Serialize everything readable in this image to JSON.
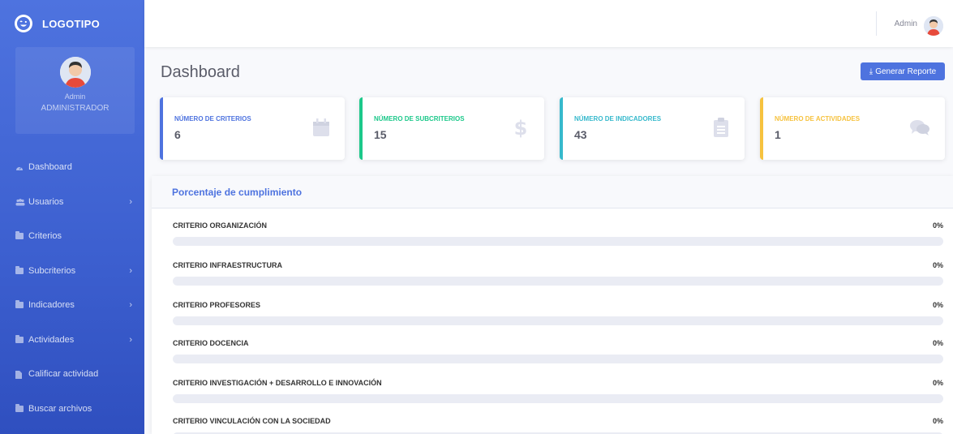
{
  "brand": {
    "name": "LOGOTIPO"
  },
  "profile": {
    "name": "Admin",
    "role": "ADMINISTRADOR"
  },
  "nav": [
    {
      "label": "Dashboard",
      "icon": "dashboard-icon",
      "chevron": false
    },
    {
      "label": "Usuarios",
      "icon": "users-icon",
      "chevron": true
    },
    {
      "label": "Criterios",
      "icon": "folder-icon",
      "chevron": false
    },
    {
      "label": "Subcriterios",
      "icon": "folder-icon",
      "chevron": true
    },
    {
      "label": "Indicadores",
      "icon": "folder-icon",
      "chevron": true
    },
    {
      "label": "Actividades",
      "icon": "folder-icon",
      "chevron": true
    },
    {
      "label": "Calificar actividad",
      "icon": "file-icon",
      "chevron": false
    },
    {
      "label": "Buscar archivos",
      "icon": "folder-icon",
      "chevron": false
    }
  ],
  "topbar": {
    "user": "Admin"
  },
  "page": {
    "title": "Dashboard",
    "report_button": "Generar Reporte"
  },
  "cards": [
    {
      "label": "NÚMERO DE CRITERIOS",
      "value": "6",
      "color": "#4e73df",
      "icon": "calendar-icon"
    },
    {
      "label": "NÚMERO DE SUBCRITERIOS",
      "value": "15",
      "color": "#1cc88a",
      "icon": "dollar-icon"
    },
    {
      "label": "NÚMERO DE INDICADORES",
      "value": "43",
      "color": "#36b9cc",
      "icon": "clipboard-icon"
    },
    {
      "label": "NÚMERO DE ACTIVIDADES",
      "value": "1",
      "color": "#f6c23e",
      "icon": "comments-icon"
    }
  ],
  "progress": {
    "title": "Porcentaje de cumplimiento",
    "items": [
      {
        "label": "CRITERIO ORGANIZACIÓN",
        "percent": "0%",
        "value": 0
      },
      {
        "label": "CRITERIO INFRAESTRUCTURA",
        "percent": "0%",
        "value": 0
      },
      {
        "label": "CRITERIO PROFESORES",
        "percent": "0%",
        "value": 0
      },
      {
        "label": "CRITERIO DOCENCIA",
        "percent": "0%",
        "value": 0
      },
      {
        "label": "CRITERIO INVESTIGACIÓN + DESARROLLO E INNOVACIÓN",
        "percent": "0%",
        "value": 0
      },
      {
        "label": "CRITERIO VINCULACIÓN CON LA SOCIEDAD",
        "percent": "0%",
        "value": 0
      }
    ]
  }
}
